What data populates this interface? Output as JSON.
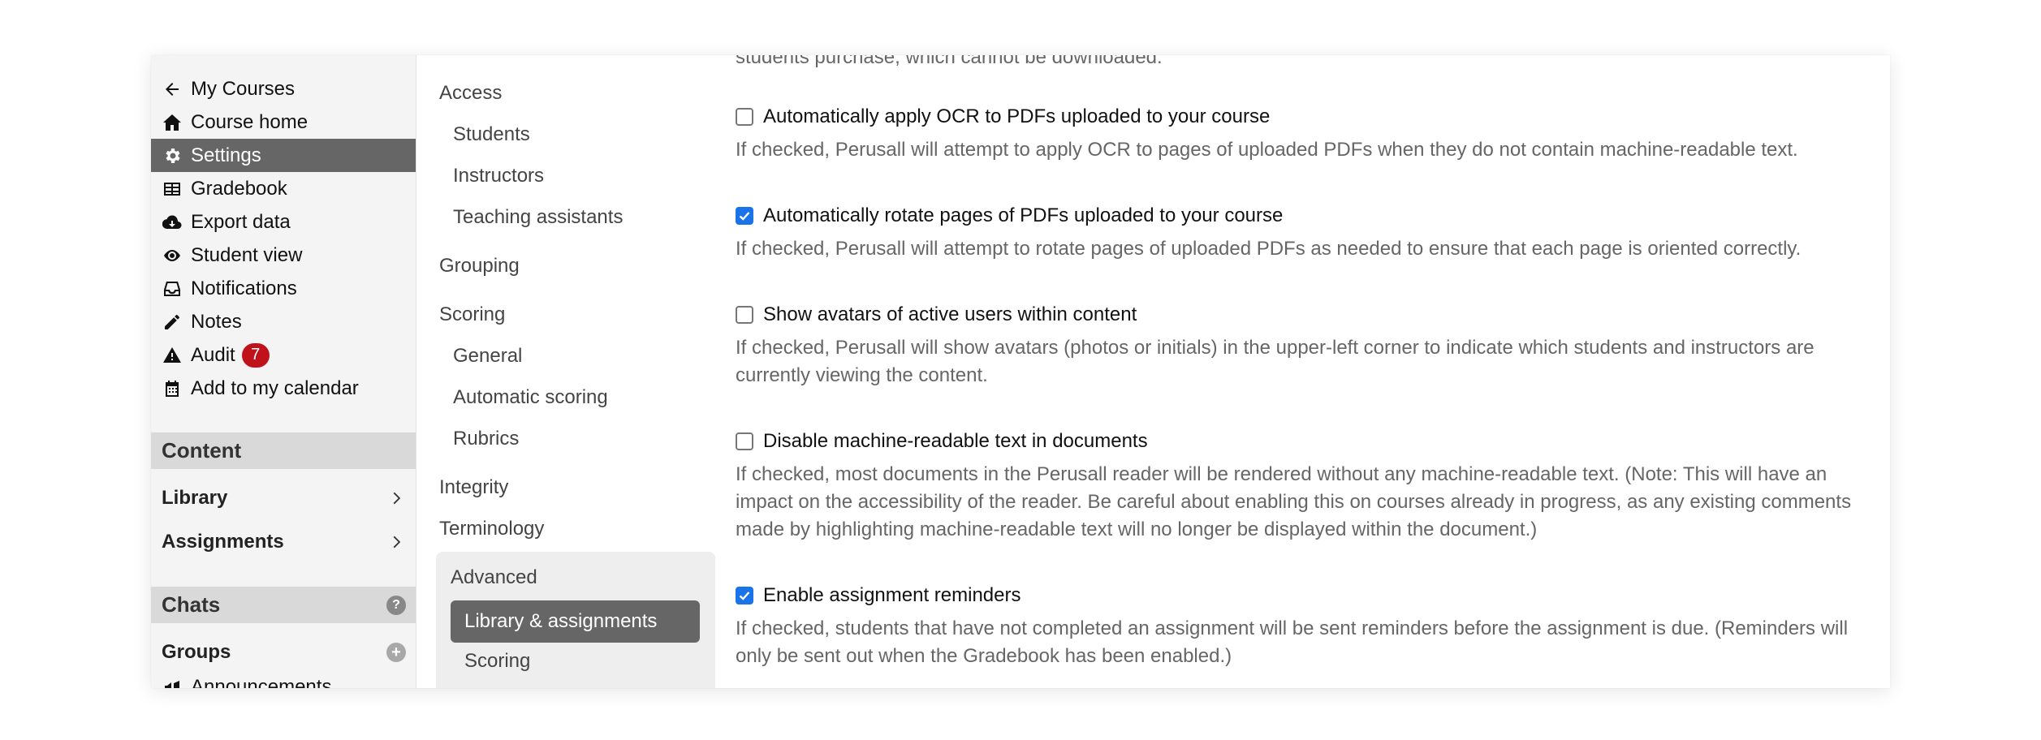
{
  "nav": {
    "items": [
      {
        "icon": "arrow-left-icon",
        "label": "My Courses"
      },
      {
        "icon": "home-icon",
        "label": "Course home"
      },
      {
        "icon": "gear-icon",
        "label": "Settings",
        "active": true
      },
      {
        "icon": "table-icon",
        "label": "Gradebook"
      },
      {
        "icon": "cloud-download-icon",
        "label": "Export data"
      },
      {
        "icon": "eye-icon",
        "label": "Student view"
      },
      {
        "icon": "inbox-icon",
        "label": "Notifications"
      },
      {
        "icon": "pencil-icon",
        "label": "Notes"
      },
      {
        "icon": "warning-icon",
        "label": "Audit",
        "badge": "7"
      },
      {
        "icon": "calendar-icon",
        "label": "Add to my calendar"
      }
    ],
    "content_header": "Content",
    "library_label": "Library",
    "assignments_label": "Assignments",
    "chats_header": "Chats",
    "chats_help": "?",
    "groups_label": "Groups",
    "groups_add": "+",
    "announcements_label": "Announcements"
  },
  "submenu": {
    "access": "Access",
    "students": "Students",
    "instructors": "Instructors",
    "teaching_assistants": "Teaching assistants",
    "grouping": "Grouping",
    "scoring": "Scoring",
    "general": "General",
    "automatic_scoring": "Automatic scoring",
    "rubrics": "Rubrics",
    "integrity": "Integrity",
    "terminology": "Terminology",
    "advanced": "Advanced",
    "library_assignments": "Library & assignments",
    "adv_scoring": "Scoring"
  },
  "main": {
    "top_cutoff": "students purchase, which cannot be downloaded.",
    "options": [
      {
        "checked": false,
        "label": "Automatically apply OCR to PDFs uploaded to your course",
        "desc": "If checked, Perusall will attempt to apply OCR to pages of uploaded PDFs when they do not contain machine-readable text."
      },
      {
        "checked": true,
        "label": "Automatically rotate pages of PDFs uploaded to your course",
        "desc": "If checked, Perusall will attempt to rotate pages of uploaded PDFs as needed to ensure that each page is oriented correctly."
      },
      {
        "checked": false,
        "label": "Show avatars of active users within content",
        "desc": "If checked, Perusall will show avatars (photos or initials) in the upper-left corner to indicate which students and instructors are currently viewing the content."
      },
      {
        "checked": false,
        "label": "Disable machine-readable text in documents",
        "desc": "If checked, most documents in the Perusall reader will be rendered without any machine-readable text. (Note: This will have an impact on the accessibility of the reader. Be careful about enabling this on courses already in progress, as any existing comments made by highlighting machine-readable text will no longer be displayed within the document.)"
      },
      {
        "checked": true,
        "label": "Enable assignment reminders",
        "desc": "If checked, students that have not completed an assignment will be sent reminders before the assignment is due. (Reminders will only be sent out when the Gradebook has been enabled.)"
      }
    ]
  },
  "colors": {
    "accent": "#1a73e8",
    "active_bg": "#666666",
    "badge": "#c0121b"
  }
}
